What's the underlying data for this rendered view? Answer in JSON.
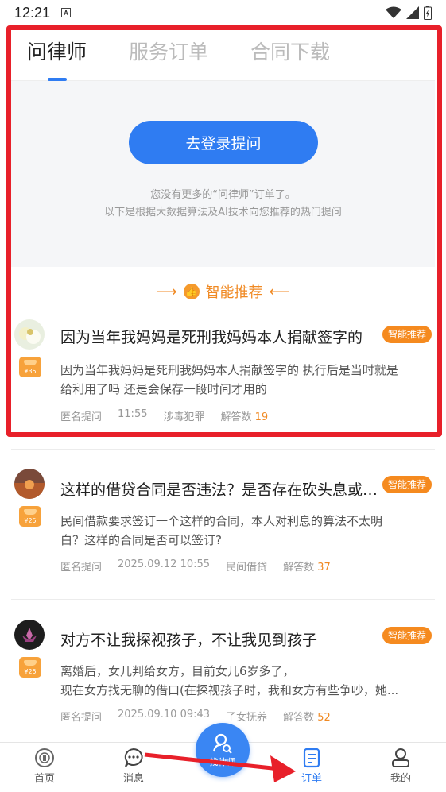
{
  "status_bar": {
    "time": "12:21",
    "badge": "A"
  },
  "tabs": [
    {
      "label": "问律师",
      "active": true
    },
    {
      "label": "服务订单",
      "active": false
    },
    {
      "label": "合同下载",
      "active": false
    }
  ],
  "login": {
    "button_label": "去登录提问",
    "hint_line1": "您没有更多的“问律师”订单了。",
    "hint_line2": "以下是根据大数据算法及AI技术向您推荐的热门提问"
  },
  "recommend_label": "智能推荐",
  "questions": [
    {
      "title": "因为当年我妈妈是死刑我妈妈本人捐献签字的",
      "tag": "智能推荐",
      "price": "¥35",
      "desc_line1": "因为当年我妈妈是死刑我妈妈本人捐献签字的 执行后是当时就是",
      "desc_line2": "给利用了吗 还是会保存一段时间才用的",
      "asker": "匿名提问",
      "time": "11:55",
      "category": "涉毒犯罪",
      "answers_label": "解答数",
      "answers": "19"
    },
    {
      "title": "这样的借贷合同是否违法？是否存在砍头息或者...",
      "tag": "智能推荐",
      "price": "¥25",
      "desc_line1": "民间借款要求签订一个这样的合同，本人对利息的算法不太明",
      "desc_line2": "白？这样的合同是否可以签订?",
      "asker": "匿名提问",
      "time": "2025.09.12  10:55",
      "category": "民间借贷",
      "answers_label": "解答数",
      "answers": "37"
    },
    {
      "title": "对方不让我探视孩子，不让我见到孩子",
      "tag": "智能推荐",
      "price": "¥25",
      "desc_line1": "  离婚后，女儿判给女方，目前女儿6岁多了，",
      "desc_line2": "现在女方找无聊的借口(在探视孩子时，我和女方有些争吵，她...",
      "asker": "匿名提问",
      "time": "2025.09.10  09:43",
      "category": "子女抚养",
      "answers_label": "解答数",
      "answers": "52"
    }
  ],
  "bottom_nav": [
    {
      "label": "首页",
      "icon": "home-icon",
      "active": false
    },
    {
      "label": "消息",
      "icon": "message-icon",
      "active": false
    },
    {
      "label": "找律师",
      "icon": "find-lawyer-icon",
      "active": false
    },
    {
      "label": "订单",
      "icon": "order-icon",
      "active": true
    },
    {
      "label": "我的",
      "icon": "profile-icon",
      "active": false
    }
  ],
  "colors": {
    "accent": "#2f7cf2",
    "orange": "#f08a24",
    "highlight": "#e8202a"
  }
}
